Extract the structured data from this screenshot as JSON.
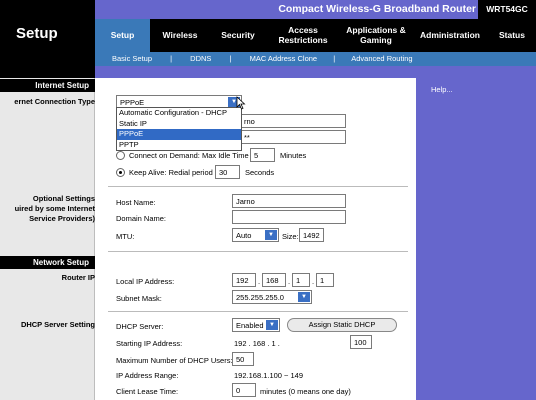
{
  "header": {
    "title": "Setup",
    "product": "Compact Wireless-G Broadband Router",
    "model": "WRT54GC"
  },
  "tabs": [
    {
      "label": "Setup",
      "active": true
    },
    {
      "label": "Wireless"
    },
    {
      "label": "Security"
    },
    {
      "label": "Access Restrictions"
    },
    {
      "label": "Applications & Gaming"
    },
    {
      "label": "Administration"
    },
    {
      "label": "Status"
    }
  ],
  "subtabs": [
    "Basic Setup",
    "|",
    "DDNS",
    "|",
    "MAC Address Clone",
    "|",
    "Advanced Routing"
  ],
  "sections": {
    "internet_setup": "Internet Setup",
    "network_setup": "Network Setup"
  },
  "left_labels": {
    "connection_type": "ernet Connection Type",
    "optional_1": "Optional Settings",
    "optional_2": "uired by some Internet",
    "optional_3": "Service Providers)",
    "router_ip": "Router IP",
    "dhcp": "DHCP Server Setting"
  },
  "help": {
    "label": "Help..."
  },
  "connection": {
    "selected": "PPPoE",
    "options": [
      "Automatic Configuration - DHCP",
      "Static IP",
      "PPPoE",
      "PPTP"
    ],
    "username_partial": "rno",
    "password_partial": "**",
    "connect_on_demand": "Connect on Demand: Max Idle Time",
    "idle_value": "5",
    "idle_unit": "Minutes",
    "keep_alive": "Keep Alive: Redial period",
    "redial_value": "30",
    "redial_unit": "Seconds"
  },
  "optional": {
    "host_label": "Host Name:",
    "host_value": "Jarno",
    "domain_label": "Domain Name:",
    "domain_value": "",
    "mtu_label": "MTU:",
    "mtu_mode": "Auto",
    "size_label": "Size:",
    "size_value": "1492"
  },
  "router_ip": {
    "local_label": "Local IP Address:",
    "ip": [
      "192",
      "168",
      "1",
      "1"
    ],
    "dots": ".",
    "mask_label": "Subnet Mask:",
    "mask_value": "255.255.255.0"
  },
  "dhcp": {
    "server_label": "DHCP Server:",
    "server_value": "Enabled",
    "static_button": "Assign Static DHCP",
    "start_label": "Starting IP Address:",
    "start_prefix": "192 . 168 . 1 .",
    "start_value": "100",
    "max_label": "Maximum Number of DHCP Users:",
    "max_value": "50",
    "range_label": "IP Address Range:",
    "range_value": "192.168.1.100 ~ 149",
    "lease_label": "Client Lease Time:",
    "lease_value": "0",
    "lease_unit": "minutes (0 means one day)"
  },
  "colors": {
    "purple": "#6666cc",
    "blue": "#3a79b8",
    "black": "#000000",
    "selection": "#316ac5"
  }
}
